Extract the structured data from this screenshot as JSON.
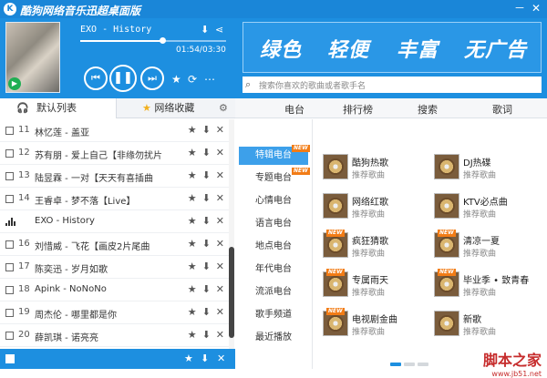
{
  "window": {
    "title": "酷狗网络音乐迅超桌面版",
    "logo": "K",
    "minimize": "－",
    "close": "✕"
  },
  "player": {
    "song_title": "EXO - History",
    "time": "01:54/03:30",
    "progress_fraction": 0.56,
    "icons": [
      "download-icon",
      "share-icon",
      "prev-icon",
      "pause-icon",
      "next-icon",
      "favorite-icon",
      "repeat-icon",
      "more-icon"
    ],
    "glyph_download": "⬇",
    "glyph_share": "⋖",
    "glyph_prev": "⏮",
    "glyph_pause": "❚❚",
    "glyph_next": "⏭",
    "glyph_favorite": "★",
    "glyph_repeat": "⟳",
    "glyph_more": "⋯",
    "glyph_cover_play": "▶"
  },
  "left_tabs": {
    "default_list": "默认列表",
    "net_fav": "网络收藏",
    "gear": "⚙"
  },
  "playlist": [
    {
      "num": "11",
      "title": "林忆莲 - 盖亚",
      "playing": false
    },
    {
      "num": "12",
      "title": "苏有朋 - 爱上自己【非缘勿扰片",
      "playing": false
    },
    {
      "num": "13",
      "title": "陆昱霖 - 一对【天天有喜插曲",
      "playing": false
    },
    {
      "num": "14",
      "title": "王睿卓 - 梦不落【Live】",
      "playing": false
    },
    {
      "num": "",
      "title": "EXO - History",
      "playing": true
    },
    {
      "num": "16",
      "title": "刘惜威 - 飞花【画皮2片尾曲",
      "playing": false
    },
    {
      "num": "17",
      "title": "陈奕迅 - 岁月如歌",
      "playing": false
    },
    {
      "num": "18",
      "title": "Apink - NoNoNo",
      "playing": false
    },
    {
      "num": "19",
      "title": "周杰伦 - 哪里都是你",
      "playing": false
    },
    {
      "num": "20",
      "title": "薛凯琪 - 诺亮亮",
      "playing": false
    }
  ],
  "row_icons": {
    "fav": "★",
    "download": "⬇",
    "delete": "✕"
  },
  "bottom_bar": {
    "fav": "★",
    "download": "⬇",
    "delete": "✕"
  },
  "banner": {
    "slogans": [
      "绿色",
      "轻便",
      "丰富",
      "无广告"
    ]
  },
  "search": {
    "placeholder": "搜索你喜欢的歌曲或者歌手名",
    "icon": "⌕"
  },
  "nav": [
    "电台",
    "排行榜",
    "搜索",
    "歌词"
  ],
  "categories": [
    {
      "label": "特辑电台",
      "active": true,
      "new": true
    },
    {
      "label": "专题电台",
      "active": false,
      "new": true
    },
    {
      "label": "心情电台",
      "active": false,
      "new": false
    },
    {
      "label": "语言电台",
      "active": false,
      "new": false
    },
    {
      "label": "地点电台",
      "active": false,
      "new": false
    },
    {
      "label": "年代电台",
      "active": false,
      "new": false
    },
    {
      "label": "流派电台",
      "active": false,
      "new": false
    },
    {
      "label": "歌手频道",
      "active": false,
      "new": false
    },
    {
      "label": "最近播放",
      "active": false,
      "new": false
    }
  ],
  "new_badge": "NEW",
  "cards": [
    {
      "title": "酷狗热歌",
      "sub": "推荐歌曲",
      "new": false
    },
    {
      "title": "DJ热碟",
      "sub": "推荐歌曲",
      "new": false
    },
    {
      "title": "网络红歌",
      "sub": "推荐歌曲",
      "new": false
    },
    {
      "title": "KTV必点曲",
      "sub": "推荐歌曲",
      "new": false
    },
    {
      "title": "疯狂猜歌",
      "sub": "推荐歌曲",
      "new": true
    },
    {
      "title": "清凉一夏",
      "sub": "推荐歌曲",
      "new": true
    },
    {
      "title": "专属雨天",
      "sub": "推荐歌曲",
      "new": true
    },
    {
      "title": "毕业季 • 致青春",
      "sub": "推荐歌曲",
      "new": true
    },
    {
      "title": "电视剧金曲",
      "sub": "推荐歌曲",
      "new": true
    },
    {
      "title": "新歌",
      "sub": "推荐歌曲",
      "new": false
    }
  ],
  "pager": {
    "pages": 3,
    "current": 1
  },
  "watermark": {
    "line1": "脚本之家",
    "line2": "www.jb51.net"
  },
  "colors": {
    "primary": "#1d8fe0",
    "badge": "#f27c16",
    "active_cat": "#3da0ea"
  }
}
